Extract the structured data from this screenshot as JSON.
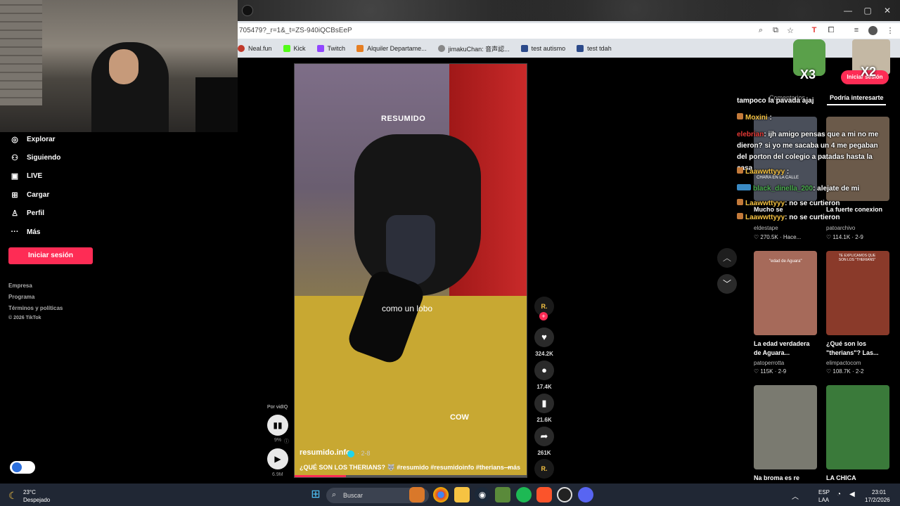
{
  "browser": {
    "url": "705479?_r=1&_t=ZS-940iQCBsEeP",
    "window_controls": {
      "minimize": "—",
      "maximize": "▢",
      "close": "✕"
    },
    "bookmarks": [
      {
        "label": "Neal.fun",
        "color": "#c0392b"
      },
      {
        "label": "Kick",
        "color": "#53fc18"
      },
      {
        "label": "Twitch",
        "color": "#9146ff"
      },
      {
        "label": "Alquiler Departame...",
        "color": "#e67e22"
      },
      {
        "label": "jimakuChan: 音声認...",
        "color": "#888888"
      },
      {
        "label": "test autismo",
        "color": "#2c4a8a"
      },
      {
        "label": "test tdah",
        "color": "#2c4a8a"
      }
    ]
  },
  "sidebar": {
    "items": [
      {
        "label": "Explorar",
        "icon": "compass-icon",
        "glyph": "◎"
      },
      {
        "label": "Siguiendo",
        "icon": "following-icon",
        "glyph": "⚇"
      },
      {
        "label": "LIVE",
        "icon": "live-icon",
        "glyph": "▣"
      },
      {
        "label": "Cargar",
        "icon": "upload-icon",
        "glyph": "⊞"
      },
      {
        "label": "Perfil",
        "icon": "profile-icon",
        "glyph": "♙"
      },
      {
        "label": "Más",
        "icon": "more-icon",
        "glyph": "···"
      }
    ],
    "login_label": "Iniciar sesión",
    "footer": [
      "Empresa",
      "Programa",
      "Términos y políticas",
      "© 2026 TikTok"
    ]
  },
  "video": {
    "overlay_title": "RESUMIDO",
    "caption": "como un lobo",
    "subtitle2": "COW",
    "author": "resumido.info",
    "date": "· 2-8",
    "description": "¿QUÉ SON LOS THERIANS? 🐺 #resumido #resumidoinfo #therians—",
    "more": "más",
    "progress": 0.22,
    "vidiq_label": "Por vidIQ",
    "vidiq_percent": "9%",
    "views": "6.9M"
  },
  "actions": {
    "avatar_letter": "R.",
    "likes": "324.2K",
    "comments": "17.4K",
    "saves": "21.6K",
    "shares": "261K"
  },
  "right_panel": {
    "tab_comments": "Comentarios",
    "tab_interest": "Podría interesarte",
    "login_label": "Iniciar sesión",
    "badge_x3": "X3",
    "badge_x2": "X2",
    "cards": [
      {
        "title": "Mucho se",
        "author": "eldestape",
        "likes": "270.5K",
        "date": "· Hace...",
        "color": "#4a4f5a"
      },
      {
        "title": "La fuerte conexion",
        "author": "patoarchivo",
        "likes": "114.1K",
        "date": "· 2-9",
        "color": "#6b5a4a"
      },
      {
        "title": "La edad verdadera de Aguara...",
        "author": "patoperrotta",
        "likes": "115K",
        "date": "· 2-9",
        "color": "#a66a5a"
      },
      {
        "title": "¿Qué son los \"therians\"? Las...",
        "author": "elimpactocom",
        "likes": "108.7K",
        "date": "· 2-2",
        "color": "#8a3a2a"
      },
      {
        "title": "Na broma es re",
        "author": "",
        "likes": "",
        "date": "",
        "color": "#7a7a70"
      },
      {
        "title": "LA CHICA",
        "author": "",
        "likes": "",
        "date": "",
        "color": "#3a7a3a"
      }
    ],
    "thumb_text": [
      "CHARA EN LA CALLE",
      "\"edad de Aguara\"",
      "TE EXPLICAMOS QUE SON LOS \"THERIANS\""
    ]
  },
  "chat": [
    {
      "user": "",
      "text": "tampoco la pavada ajaj"
    },
    {
      "user": "Moxini",
      "text": ":"
    },
    {
      "user": "elebrian",
      "text": ": ijh amigo pensas que a mi no me dieron? si yo me sacaba un 4 me pegaban del porton del colegio a patadas hasta la casa"
    },
    {
      "user": "Laawwttyyy",
      "text": ":"
    },
    {
      "user": "black_dinella_200",
      "text": ": alejate de mi"
    },
    {
      "user": "Laawwttyyy",
      "text": ": no se curtieron"
    },
    {
      "user": "Laawwttyyy",
      "text": ": no se curtieron"
    }
  ],
  "taskbar": {
    "weather_temp": "23°C",
    "weather_desc": "Despejado",
    "search_placeholder": "Buscar",
    "lang1": "ESP",
    "lang2": "LAA",
    "time": "23:01",
    "date": "17/2/2026"
  }
}
